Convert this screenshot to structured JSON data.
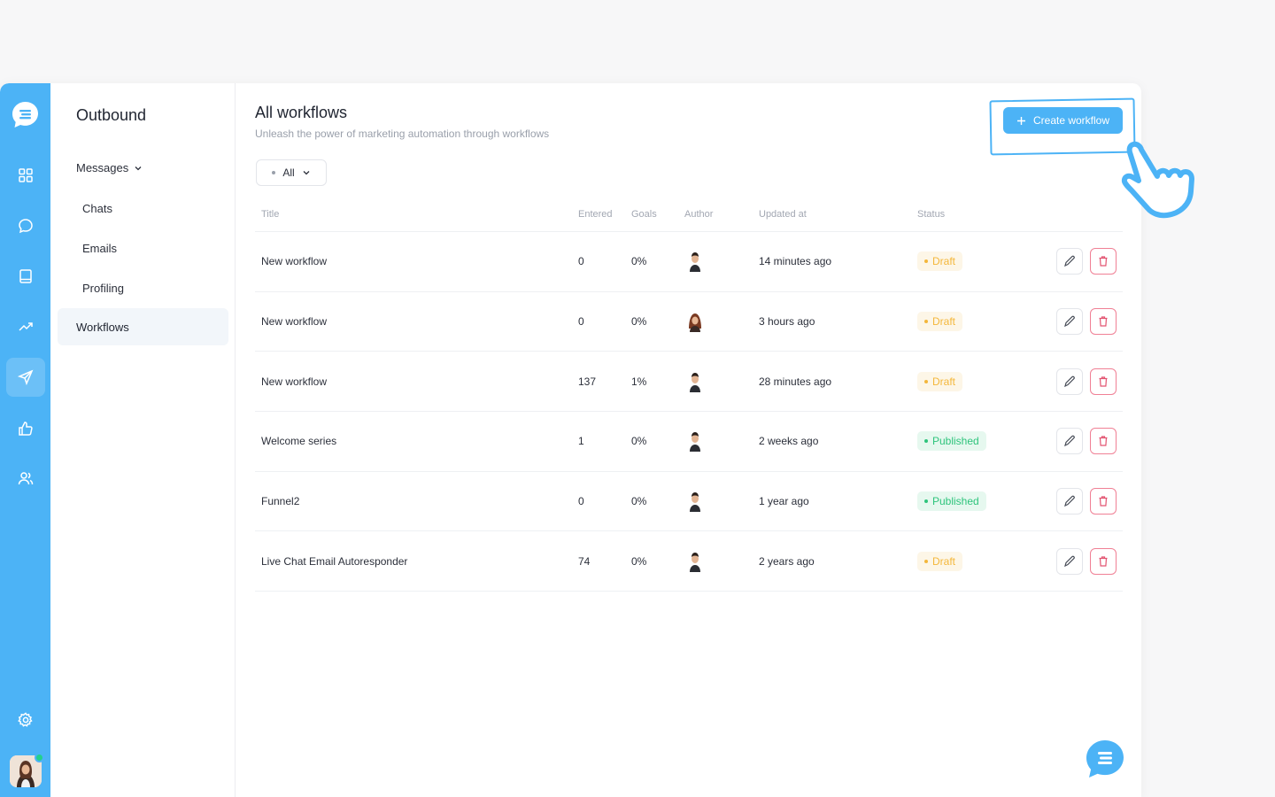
{
  "colors": {
    "accent": "#4cb3f6",
    "draft_text": "#f4b73b",
    "draft_bg": "#fdf6e7",
    "published_text": "#2ec47c",
    "published_bg": "#e6f8ef",
    "delete_border": "#f08095"
  },
  "rail": {
    "logo_icon": "chat-bubble-logo-icon",
    "items": [
      {
        "icon": "dashboard-grid-icon",
        "active": false
      },
      {
        "icon": "chat-icon",
        "active": false
      },
      {
        "icon": "book-icon",
        "active": false
      },
      {
        "icon": "trending-up-icon",
        "active": false
      },
      {
        "icon": "send-icon",
        "active": true
      },
      {
        "icon": "thumbs-up-icon",
        "active": false
      },
      {
        "icon": "users-icon",
        "active": false
      }
    ],
    "settings_icon": "gear-icon",
    "avatar_icon": "user-avatar"
  },
  "subnav": {
    "title": "Outbound",
    "group_label": "Messages",
    "links": [
      "Chats",
      "Emails",
      "Profiling"
    ],
    "active_label": "Workflows"
  },
  "main": {
    "title": "All workflows",
    "subtitle": "Unleash the power of marketing automation through workflows",
    "filter_label": "All",
    "create_button_label": "Create workflow"
  },
  "table": {
    "columns": {
      "title": "Title",
      "entered": "Entered",
      "goals": "Goals",
      "author": "Author",
      "updated": "Updated at",
      "status": "Status"
    },
    "rows": [
      {
        "title": "New workflow",
        "entered": "0",
        "goals": "0%",
        "author": "male-avatar",
        "updated": "14 minutes ago",
        "status": "Draft",
        "status_kind": "draft"
      },
      {
        "title": "New workflow",
        "entered": "0",
        "goals": "0%",
        "author": "female-avatar",
        "updated": "3 hours ago",
        "status": "Draft",
        "status_kind": "draft"
      },
      {
        "title": "New workflow",
        "entered": "137",
        "goals": "1%",
        "author": "male-avatar",
        "updated": "28 minutes ago",
        "status": "Draft",
        "status_kind": "draft"
      },
      {
        "title": "Welcome series",
        "entered": "1",
        "goals": "0%",
        "author": "male-avatar",
        "updated": "2 weeks ago",
        "status": "Published",
        "status_kind": "published"
      },
      {
        "title": "Funnel2",
        "entered": "0",
        "goals": "0%",
        "author": "male-avatar",
        "updated": "1 year ago",
        "status": "Published",
        "status_kind": "published"
      },
      {
        "title": "Live Chat Email Autoresponder",
        "entered": "74",
        "goals": "0%",
        "author": "male-avatar",
        "updated": "2 years ago",
        "status": "Draft",
        "status_kind": "draft"
      }
    ]
  },
  "overlay": {
    "pointer_icon": "hand-pointer-icon"
  },
  "chat_fab_icon": "chat-bubble-icon"
}
